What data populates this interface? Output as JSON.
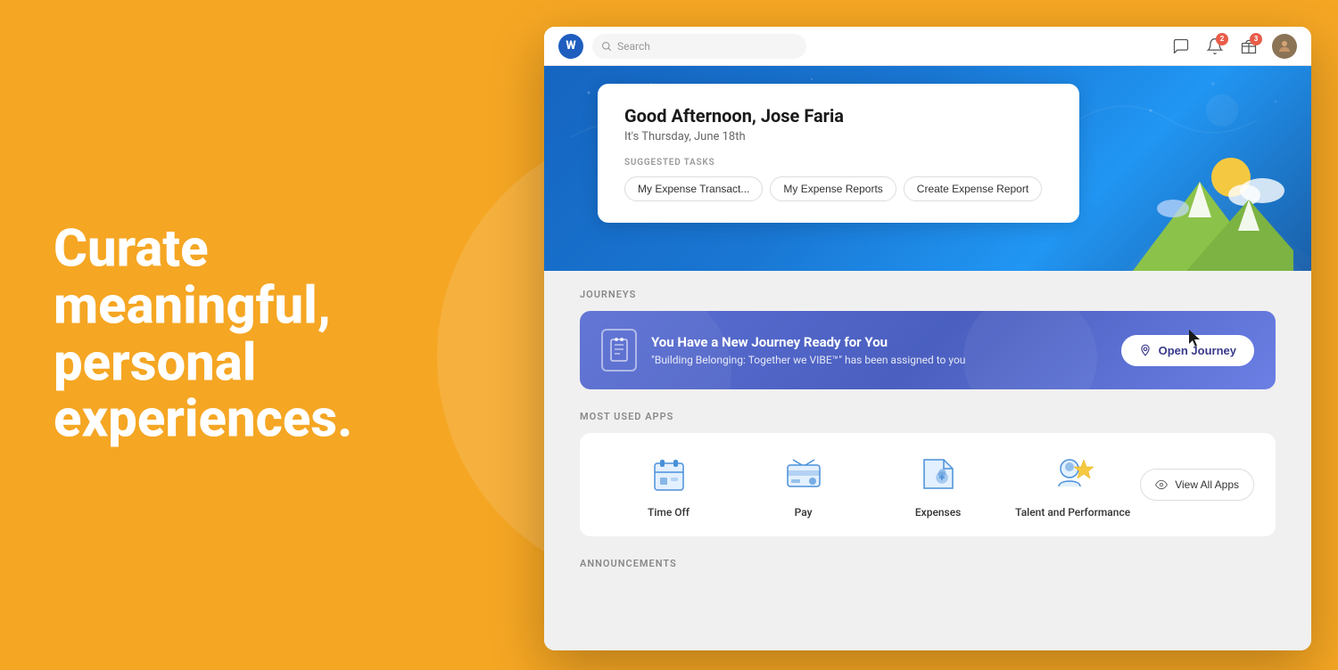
{
  "background": {
    "color": "#F5A623"
  },
  "left_panel": {
    "headline": "Curate meaningful, personal experiences."
  },
  "browser": {
    "toolbar": {
      "search_placeholder": "Search",
      "logo_letter": "W",
      "chat_icon": "💬",
      "bell_icon": "🔔",
      "gift_icon": "🎁",
      "bell_badge": "2",
      "gift_badge": "3"
    },
    "hero": {
      "greeting": "Good Afternoon, Jose Faria",
      "date": "It's Thursday, June 18th",
      "suggested_tasks_label": "SUGGESTED TASKS",
      "tasks": [
        "My Expense Transact...",
        "My Expense Reports",
        "Create Expense Report"
      ]
    },
    "journeys": {
      "section_label": "JOURNEYS",
      "card": {
        "title": "You Have a New Journey Ready for You",
        "subtitle": "\"Building Belonging: Together we VIBE™\" has been assigned to you",
        "button_label": "Open Journey"
      }
    },
    "most_used_apps": {
      "section_label": "MOST USED APPS",
      "apps": [
        {
          "label": "Time Off",
          "icon": "time_off"
        },
        {
          "label": "Pay",
          "icon": "pay"
        },
        {
          "label": "Expenses",
          "icon": "expenses"
        },
        {
          "label": "Talent and Performance",
          "icon": "talent"
        }
      ],
      "view_all_label": "View All Apps"
    },
    "announcements": {
      "section_label": "ANNOUNCEMENTS"
    }
  }
}
